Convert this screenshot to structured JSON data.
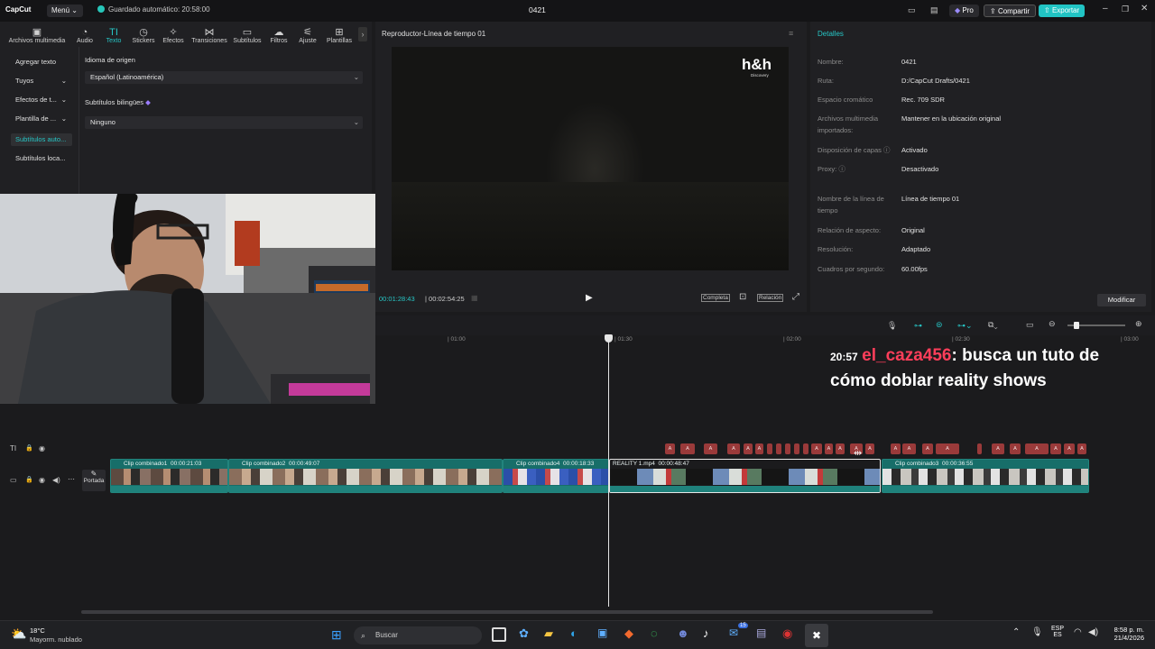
{
  "titlebar": {
    "app_name": "CapCut",
    "menu_label": "Menú",
    "autosave": "Guardado automático: 20:58:00",
    "project_name": "0421",
    "pro_label": "Pro",
    "share_label": "Compartir",
    "export_label": "Exportar"
  },
  "tools": [
    {
      "label": "Archivos multimedia",
      "icon": "media-icon"
    },
    {
      "label": "Audio",
      "icon": "audio-icon"
    },
    {
      "label": "Texto",
      "icon": "text-icon"
    },
    {
      "label": "Stickers",
      "icon": "sticker-icon"
    },
    {
      "label": "Efectos",
      "icon": "effects-icon"
    },
    {
      "label": "Transiciones",
      "icon": "transition-icon"
    },
    {
      "label": "Subtítulos",
      "icon": "subtitles-icon"
    },
    {
      "label": "Filtros",
      "icon": "filters-icon"
    },
    {
      "label": "Ajuste",
      "icon": "adjust-icon"
    },
    {
      "label": "Plantillas",
      "icon": "templates-icon"
    }
  ],
  "sidebar": {
    "items": [
      {
        "label": "Agregar texto"
      },
      {
        "label": "Tuyos"
      },
      {
        "label": "Efectos de t..."
      },
      {
        "label": "Plantilla de ..."
      },
      {
        "label": "Subtítulos auto..."
      },
      {
        "label": "Subtítulos loca..."
      }
    ]
  },
  "captions_panel": {
    "source_label": "Idioma de origen",
    "source_value": "Español (Latinoamérica)",
    "bilingual_label": "Subtítulos bilingües",
    "bilingual_value": "Ninguno"
  },
  "player": {
    "title": "Reproductor-Línea de tiempo 01",
    "watermark": "h&h",
    "watermark_sub": "Discovery",
    "current_time": "00:01:28:43",
    "total_time": "00:02:54:25",
    "full_label": "Completa",
    "ratio_label": "Relación"
  },
  "details": {
    "title": "Detalles",
    "rows": [
      {
        "key": "Nombre:",
        "value": "0421"
      },
      {
        "key": "Ruta:",
        "value": "D:/CapCut Drafts/0421"
      },
      {
        "key": "Espacio cromático",
        "value": "Rec. 709 SDR"
      },
      {
        "key": "Archivos multimedia importados:",
        "value": "Mantener en la ubicación original"
      },
      {
        "key": "Disposición de capas",
        "value": "Activado"
      },
      {
        "key": "Proxy:",
        "value": "Desactivado"
      },
      {
        "key": "Nombre de la línea de tiempo",
        "value": "Línea de tiempo 01"
      },
      {
        "key": "Relación de aspecto:",
        "value": "Original"
      },
      {
        "key": "Resolución:",
        "value": "Adaptado"
      },
      {
        "key": "Cuadros por segundo:",
        "value": "60.00fps"
      }
    ],
    "modify_label": "Modificar"
  },
  "timeline": {
    "ruler": [
      "01:00",
      "01:30",
      "02:00",
      "02:30",
      "03:00"
    ],
    "cover_label": "Portada",
    "clips": [
      {
        "label": "Clip combinado1",
        "duration": "00:00:21:03"
      },
      {
        "label": "Clip combinado2",
        "duration": "00:00:49:07"
      },
      {
        "label": "Clip combinado4",
        "duration": "00:00:18:33"
      },
      {
        "label": "REALITY 1.mp4",
        "duration": "00:00:48:47"
      },
      {
        "label": "Clip combinado3",
        "duration": "00:00:36:55"
      }
    ]
  },
  "chat": {
    "time": "20:57",
    "user": "el_caza456",
    "message_line1": ": busca un tuto de",
    "message_line2": "cómo doblar reality shows"
  },
  "taskbar": {
    "weather_temp": "18°C",
    "weather_desc": "Mayorm. nublado",
    "search_placeholder": "Buscar",
    "lang1": "ESP",
    "lang2": "ES",
    "clock_time": "8:58 p. m.",
    "clock_date": "21/4/2026",
    "badge": "15"
  }
}
